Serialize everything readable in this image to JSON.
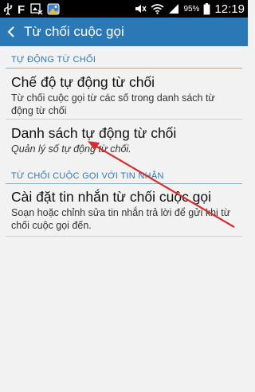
{
  "status_bar": {
    "battery_percent": "95%",
    "time": "12:19",
    "left_icons": [
      "usb-icon",
      "facebook-icon",
      "image-icon",
      "photo-icon"
    ],
    "right_icons": [
      "mute-icon",
      "wifi-icon",
      "signal-icon",
      "battery-icon"
    ]
  },
  "action_bar": {
    "title": "Từ chối cuộc gọi",
    "color": "#2b78b6"
  },
  "sections": [
    {
      "header": "TỰ ĐỘNG TỪ CHỐI",
      "items": [
        {
          "title": "Chế độ tự động từ chối",
          "subtitle": "Từ chối cuộc gọi từ các số trong danh sách từ động từ chối"
        },
        {
          "title": "Danh sách tự động từ chối",
          "subtitle": "Quản lý số tự động từ chối."
        }
      ]
    },
    {
      "header": "TỪ CHỐI CUỘC GỌI VỚI TIN NHẮN",
      "items": [
        {
          "title": "Cài đặt tin nhắn từ chối cuộc gọi",
          "subtitle": "Soạn hoặc chỉnh sửa tin nhắn trả lời để gửi khi từ chối cuộc gọi đến."
        }
      ]
    }
  ],
  "annotation": {
    "color": "#d32f2f"
  }
}
